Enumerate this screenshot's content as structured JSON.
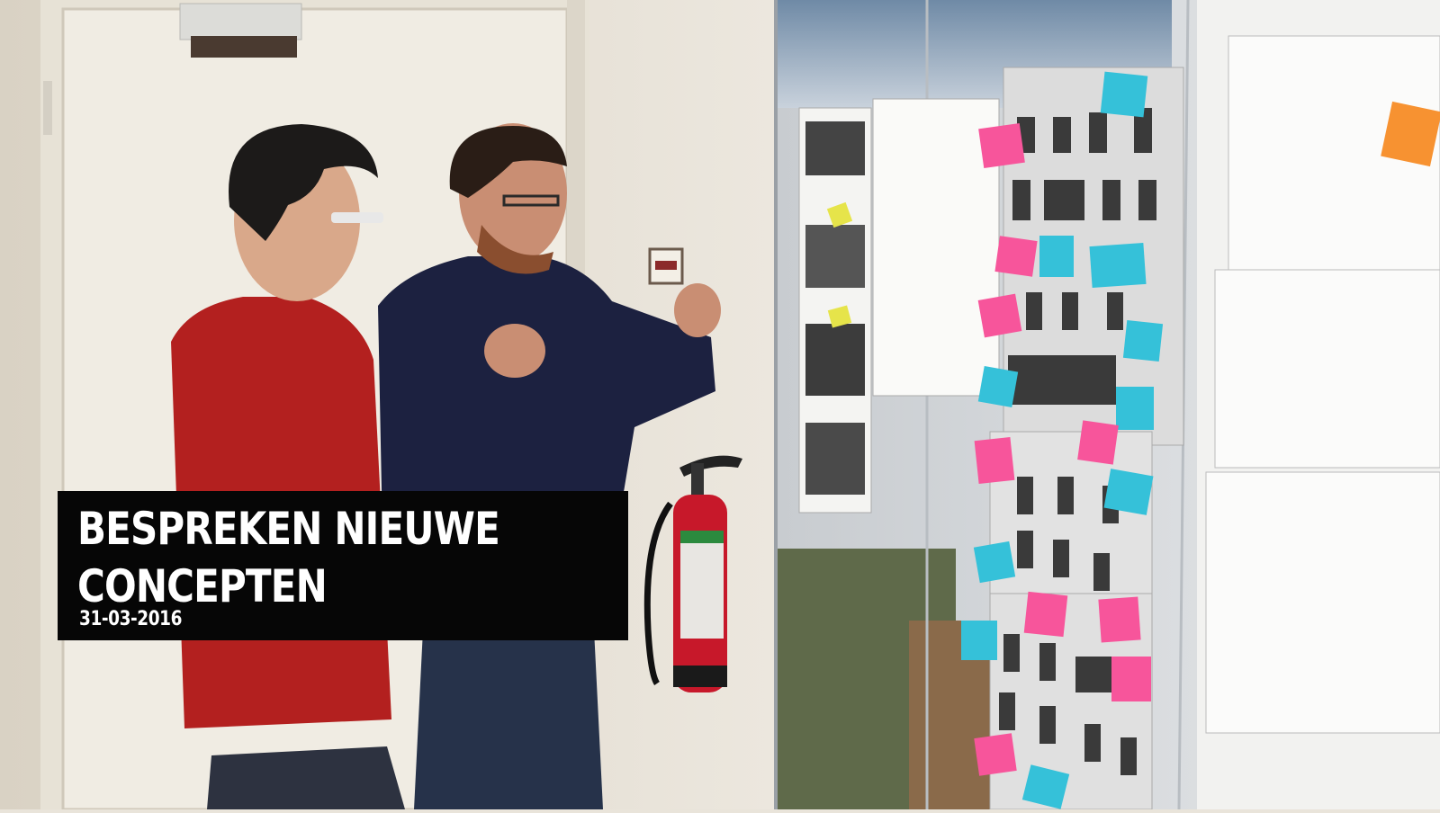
{
  "caption": {
    "title": "BESPREKEN NIEUWE CONCEPTEN",
    "date": "31-03-2016"
  },
  "colors": {
    "caption_bg": "#060606",
    "caption_text": "#ffffff",
    "sticky_pink": "#f7559b",
    "sticky_cyan": "#35c1d9",
    "sticky_orange": "#f79231",
    "sticky_yellow": "#e6e44a",
    "sweater_red": "#b3201f",
    "sweater_navy": "#1c2140",
    "extinguisher_red": "#c7182a"
  }
}
